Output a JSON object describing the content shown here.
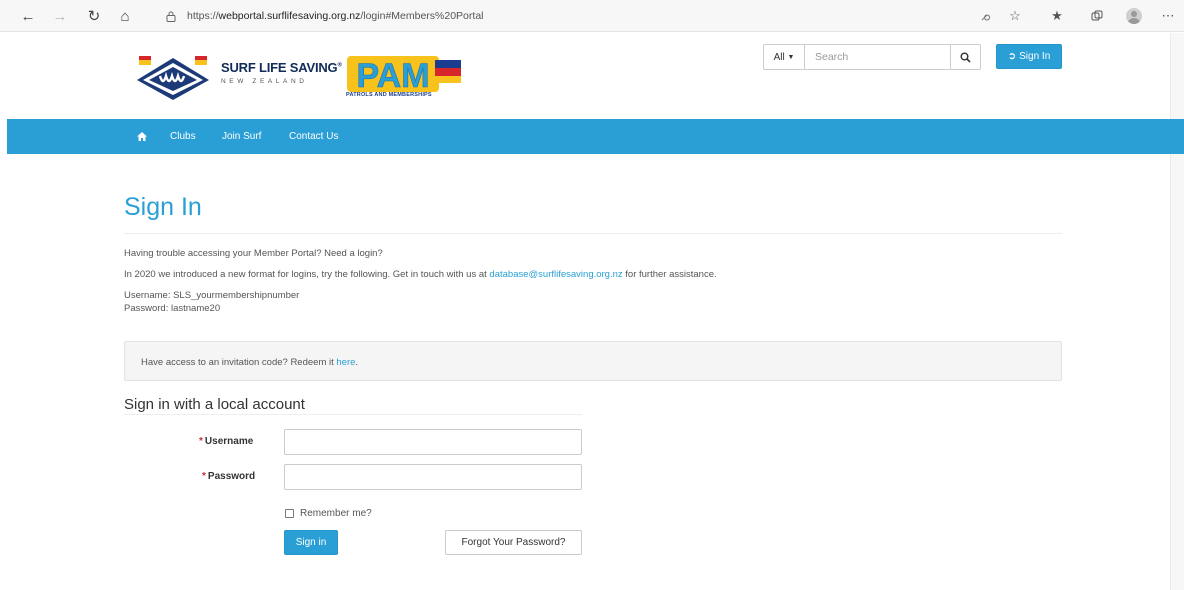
{
  "browser": {
    "url_prefix": "https://",
    "url_host": "webportal.surflifesaving.org.nz",
    "url_path": "/login#Members%20Portal",
    "icons": [
      "back-arrow-icon",
      "forward-arrow-icon",
      "reload-icon",
      "home-icon",
      "lock-icon",
      "read-aloud-icon",
      "favorites-add-icon",
      "favorites-icon",
      "collections-icon",
      "profile-icon",
      "more-icon"
    ]
  },
  "header": {
    "brand_title": "SURF LIFE SAVING",
    "brand_reg": "®",
    "brand_subtitle": "NEW ZEALAND",
    "pam_text": "PAM",
    "pam_subtitle": "PATROLS AND MEMBERSHIPS",
    "search_scope": "All",
    "search_placeholder": "Search",
    "signin_label": "Sign In"
  },
  "nav": {
    "items": [
      "Clubs",
      "Join Surf",
      "Contact Us"
    ]
  },
  "main": {
    "title": "Sign In",
    "trouble_text": "Having trouble accessing your Member Portal? Need a login?",
    "format_text_before": "In 2020 we introduced a new format for logins, try the following. Get in touch with us at ",
    "format_email": "database@surflifesaving.org.nz",
    "format_text_after": " for further assistance.",
    "username_hint": "Username: SLS_yourmembershipnumber",
    "password_hint": "Password: lastname20",
    "invite_text": "Have access to an invitation code? Redeem it ",
    "invite_link": "here",
    "invite_end": "."
  },
  "form": {
    "section_title": "Sign in with a local account",
    "required_mark": "*",
    "username_label": "Username",
    "password_label": "Password",
    "username_value": "",
    "password_value": "",
    "remember_label": "Remember me?",
    "remember_checked": false,
    "signin_button": "Sign in",
    "forgot_button": "Forgot Your Password?"
  },
  "colors": {
    "primary": "#2a9fd6",
    "required": "#cc3333"
  }
}
